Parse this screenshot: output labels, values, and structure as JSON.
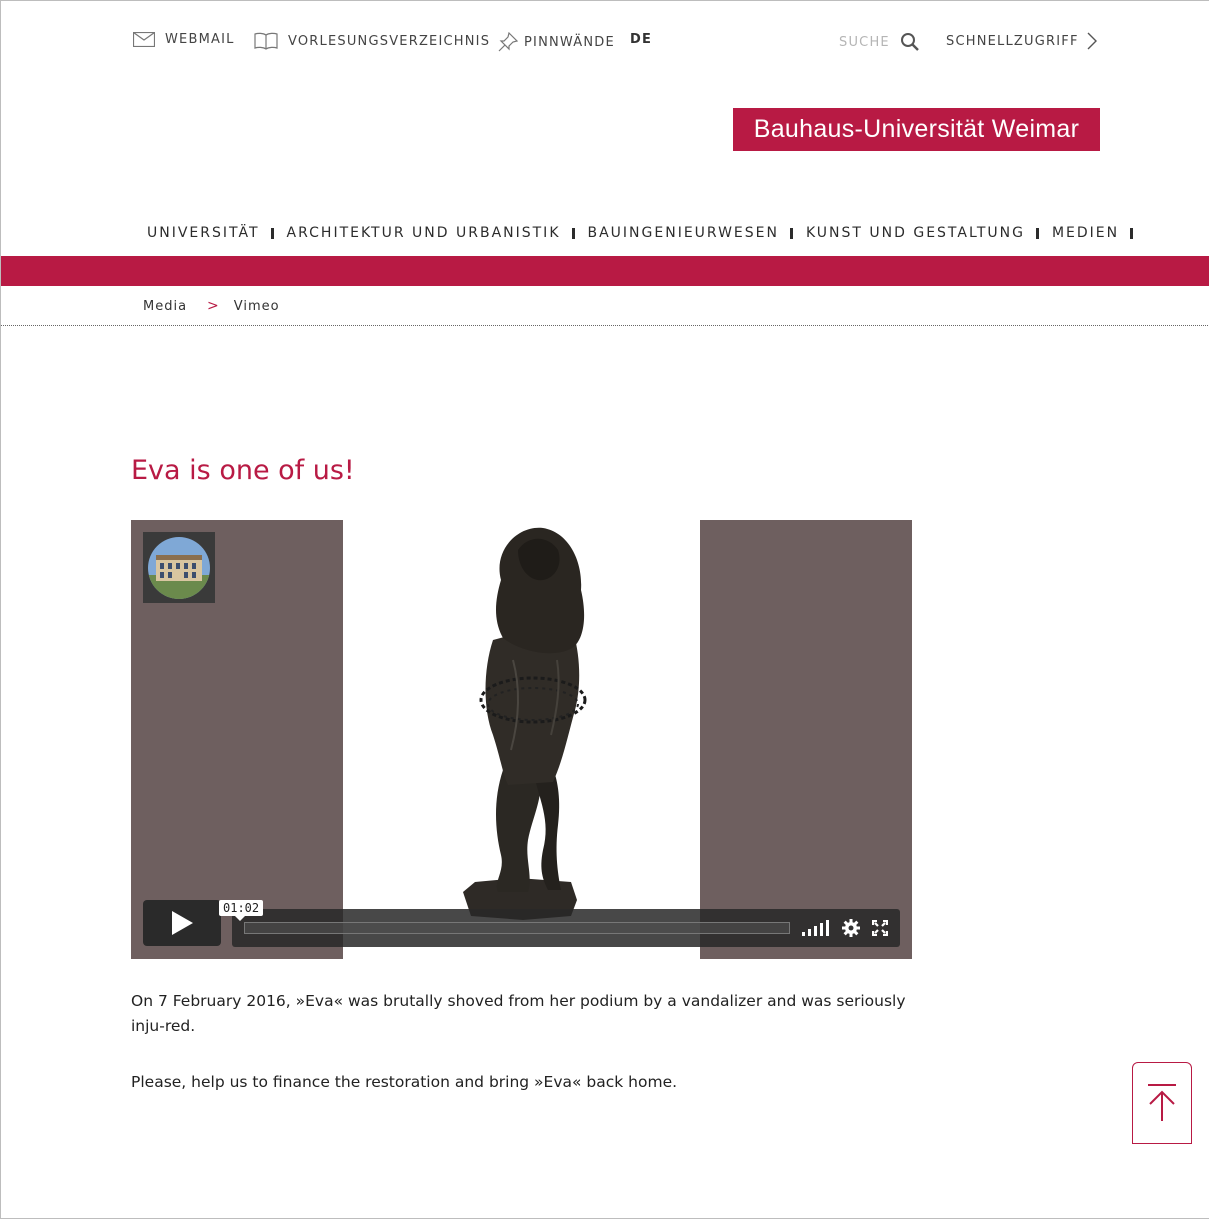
{
  "utility_nav": {
    "webmail": "WEBMAIL",
    "vorlesungsverzeichnis": "VORLESUNGSVERZEICHNIS",
    "pinnwaende": "PINNWÄNDE",
    "language": "DE",
    "search": "SUCHE",
    "schnellzugriff": "SCHNELLZUGRIFF"
  },
  "logo": {
    "text": "Bauhaus-Universität Weimar"
  },
  "main_nav": {
    "items": [
      "UNIVERSITÄT",
      "ARCHITEKTUR UND URBANISTIK",
      "BAUINGENIEURWESEN",
      "KUNST UND GESTALTUNG",
      "MEDIEN"
    ]
  },
  "breadcrumb": {
    "items": [
      "Media",
      "Vimeo"
    ]
  },
  "page": {
    "title": "Eva is one of us!",
    "paragraphs": [
      "On 7 February 2016, »Eva« was brutally shoved from her podium by a vandalizer and was seriously inju-red.",
      "Please, help us to finance the restoration and bring »Eva« back home."
    ]
  },
  "video": {
    "timecode": "01:02",
    "icons": [
      "play-icon",
      "volume-icon",
      "settings-icon",
      "fullscreen-icon"
    ]
  },
  "colors": {
    "brand": "#b81a44",
    "video_side": "#6e5f5f"
  }
}
